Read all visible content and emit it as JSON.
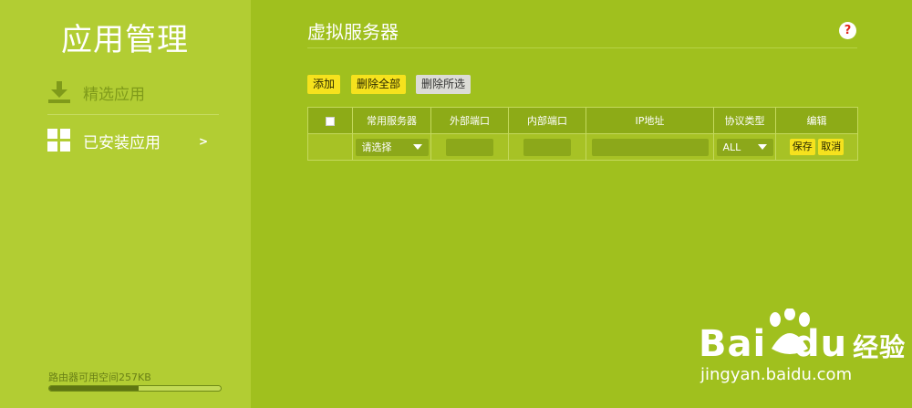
{
  "sidebar": {
    "title": "应用管理",
    "items": [
      {
        "label": "精选应用"
      },
      {
        "label": "已安装应用",
        "chevron": ">"
      }
    ],
    "storage": {
      "text": "路由器可用空间257KB",
      "used_fraction": 0.52
    }
  },
  "main": {
    "title": "虚拟服务器",
    "help": "?",
    "buttons": {
      "add": "添加",
      "delete_all": "删除全部",
      "delete_selected": "删除所选"
    },
    "table": {
      "headers": [
        "常用服务器",
        "外部端口",
        "内部端口",
        "IP地址",
        "协议类型",
        "编辑"
      ],
      "row": {
        "server_select": "请选择",
        "protocol_select": "ALL",
        "save": "保存",
        "cancel": "取消"
      }
    }
  },
  "watermark": {
    "logo": "Bai  du",
    "logo_cn": "经验",
    "url": "jingyan.baidu.com"
  },
  "colors": {
    "sidebar_bg": "#b2cd33",
    "main_bg": "#a0c01e",
    "button_yellow": "#f6e21d",
    "help_red": "#e0281c"
  }
}
